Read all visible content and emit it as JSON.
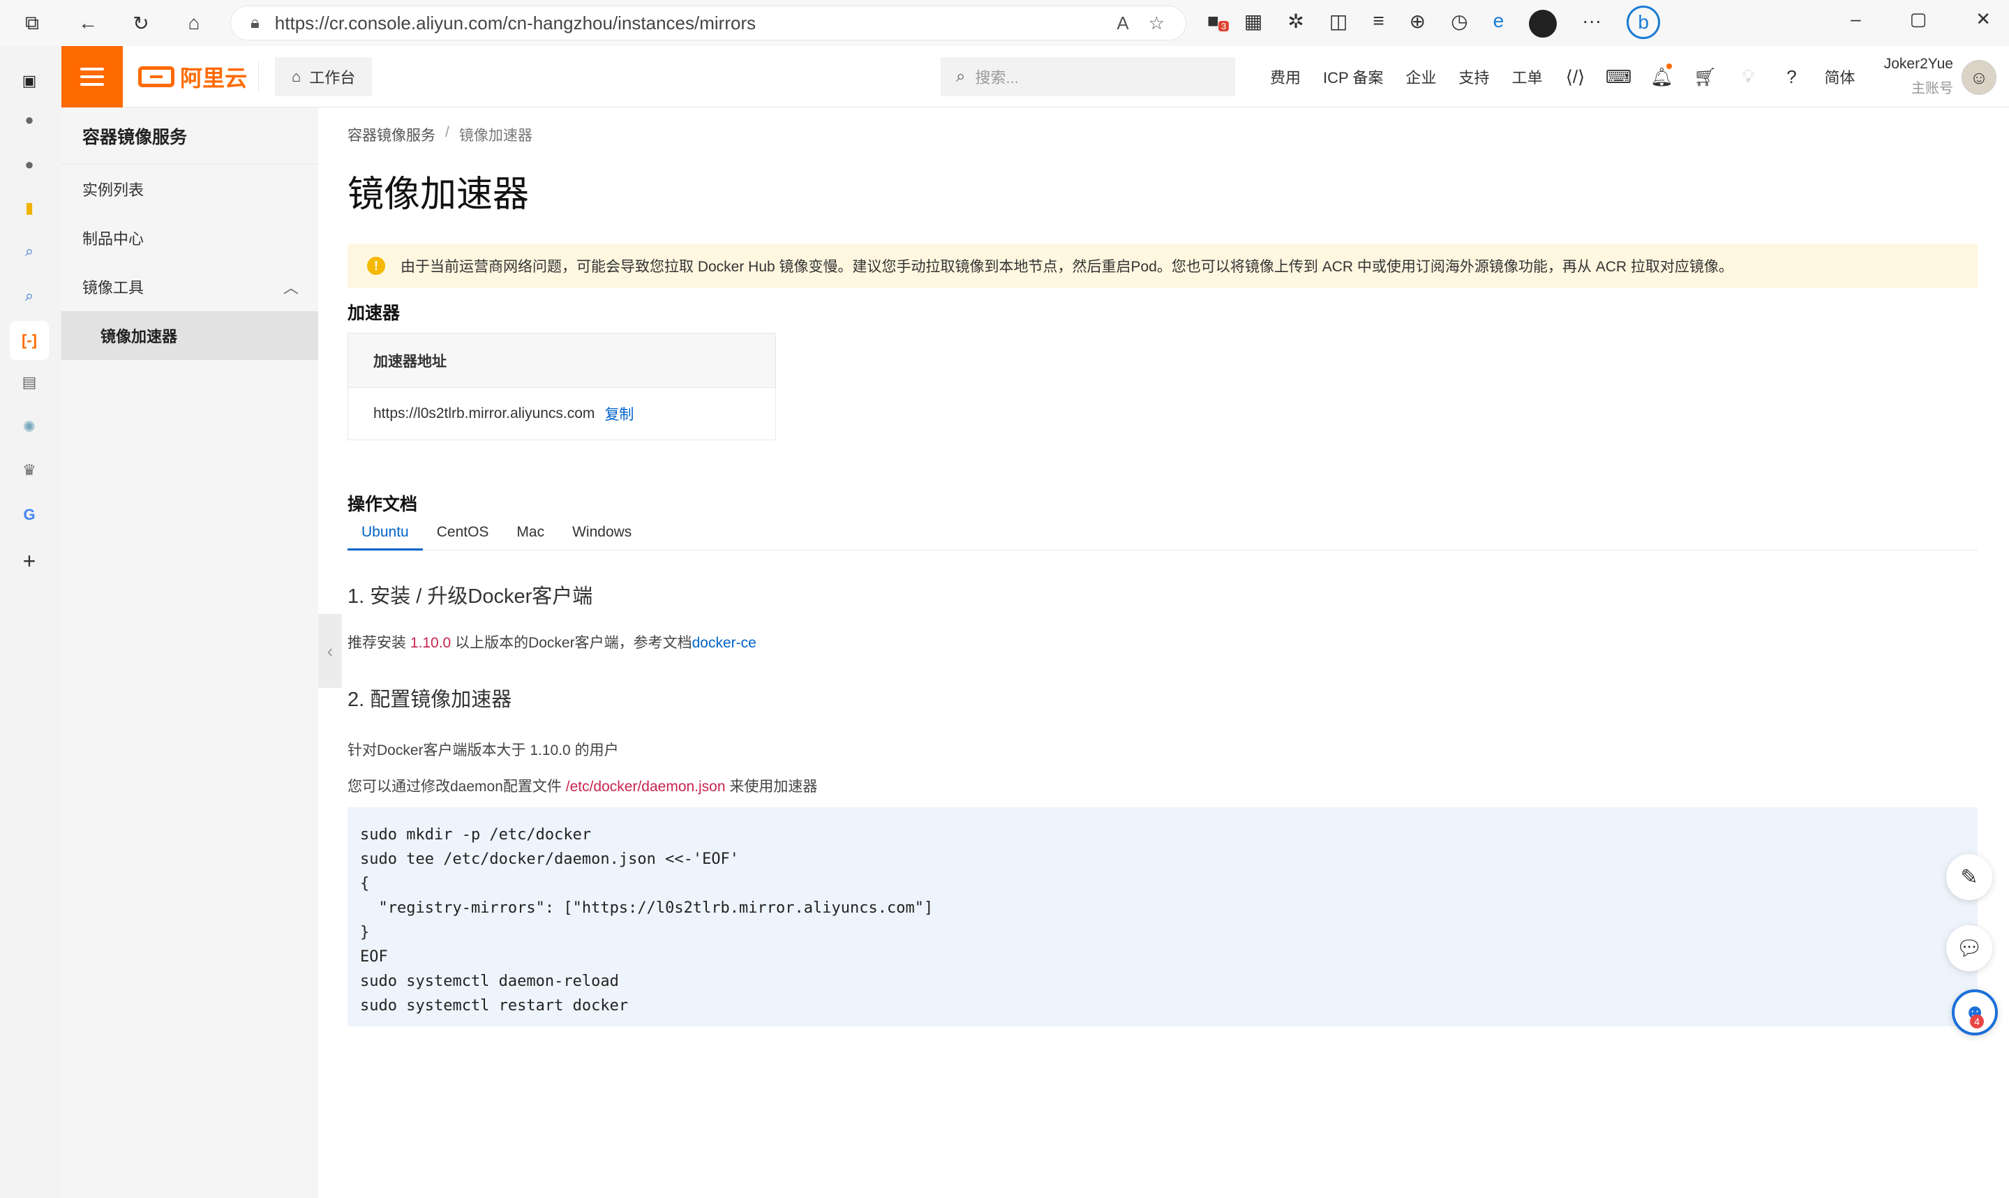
{
  "browser": {
    "url": "https://cr.console.aliyun.com/cn-hangzhou/instances/mirrors",
    "tab_badge": "3"
  },
  "topnav": {
    "logo_text": "阿里云",
    "workbench": "工作台",
    "search_placeholder": "搜索...",
    "links": [
      "费用",
      "ICP 备案",
      "企业",
      "支持",
      "工单"
    ],
    "lang": "简体",
    "user_name": "Joker2Yue",
    "user_sub": "主账号",
    "accent_color": "#ff6a00"
  },
  "sidebar": {
    "title": "容器镜像服务",
    "items": [
      {
        "label": "实例列表"
      },
      {
        "label": "制品中心"
      },
      {
        "label": "镜像工具"
      },
      {
        "label": "镜像加速器"
      }
    ]
  },
  "main": {
    "breadcrumb": [
      "容器镜像服务",
      "/",
      "镜像加速器"
    ],
    "title": "镜像加速器",
    "alert": "由于当前运营商网络问题，可能会导致您拉取 Docker Hub 镜像变慢。建议您手动拉取镜像到本地节点，然后重启Pod。您也可以将镜像上传到 ACR 中或使用订阅海外源镜像功能，再从 ACR 拉取对应镜像。",
    "accelerator_section": "加速器",
    "accelerator_header": "加速器地址",
    "accelerator_url": "https://l0s2tlrb.mirror.aliyuncs.com",
    "copy_label": "复制",
    "docs_section": "操作文档",
    "tabs": [
      "Ubuntu",
      "CentOS",
      "Mac",
      "Windows"
    ],
    "step1_title": "1. 安装 / 升级Docker客户端",
    "step1_pre": "推荐安装 ",
    "step1_version": "1.10.0",
    "step1_mid": " 以上版本的Docker客户端，参考文档",
    "step1_link": "docker-ce",
    "step2_title": "2. 配置镜像加速器",
    "step2_line1": "针对Docker客户端版本大于 1.10.0 的用户",
    "step2_line2_pre": "您可以通过修改daemon配置文件 ",
    "step2_line2_path": "/etc/docker/daemon.json",
    "step2_line2_post": " 来使用加速器",
    "code": "sudo mkdir -p /etc/docker\nsudo tee /etc/docker/daemon.json <<-'EOF'\n{\n  \"registry-mirrors\": [\"https://l0s2tlrb.mirror.aliyuncs.com\"]\n}\nEOF\nsudo systemctl daemon-reload\nsudo systemctl restart docker"
  },
  "float": {
    "bot_badge": "4"
  }
}
